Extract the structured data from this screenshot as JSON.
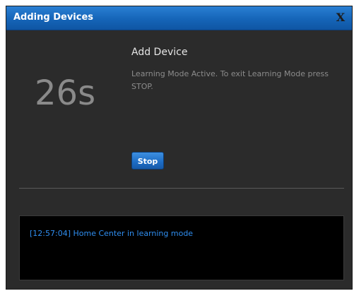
{
  "dialog": {
    "title": "Adding Devices",
    "close_label": "X"
  },
  "countdown": "26s",
  "content": {
    "heading": "Add Device",
    "message": "Learning Mode Active. To exit Learning Mode press STOP.",
    "stop_label": "Stop"
  },
  "log": {
    "lines": [
      "[12:57:04] Home Center in learning mode"
    ]
  },
  "colors": {
    "titlebar": "#1565b8",
    "background": "#2b2b2b",
    "log_text": "#2f8ef0"
  }
}
